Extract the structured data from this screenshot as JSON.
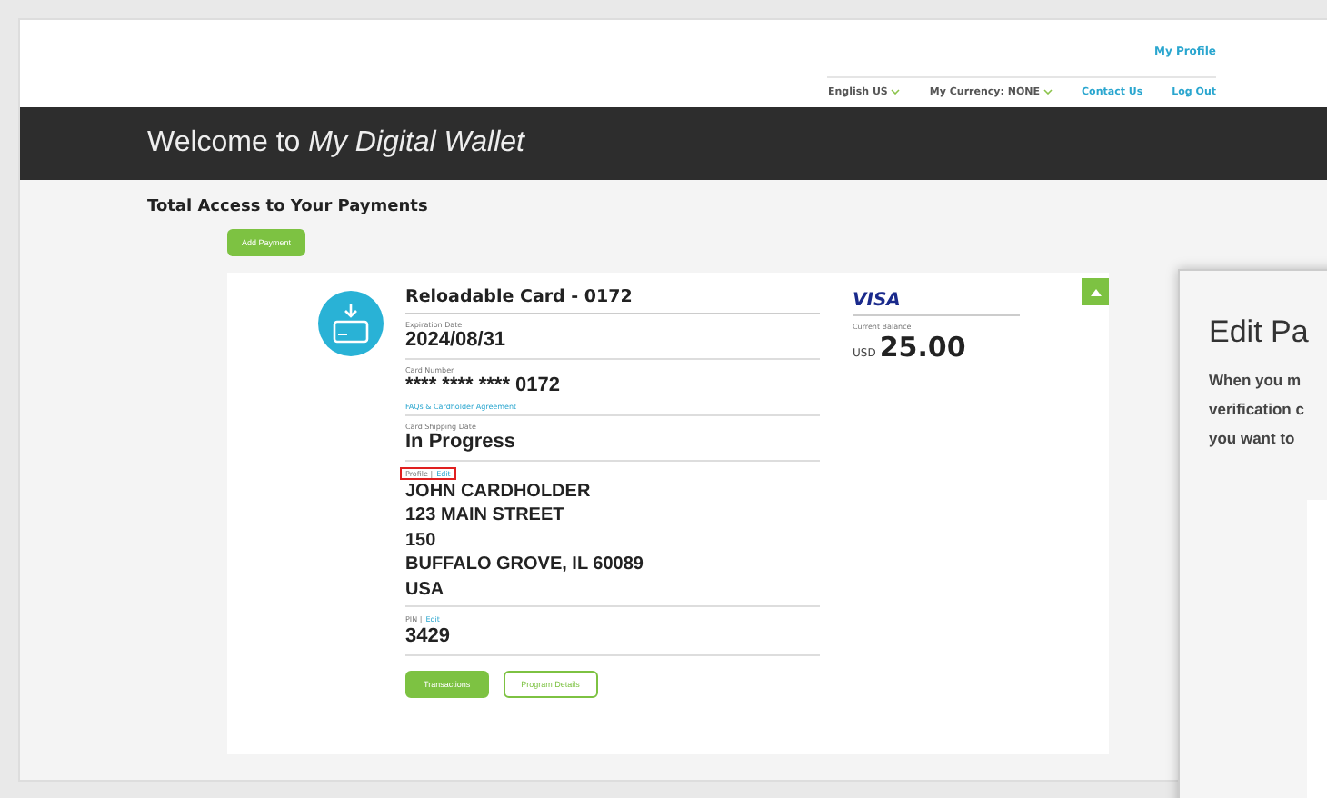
{
  "header": {
    "top_link": "My Profile",
    "menu": [
      {
        "label": "English US",
        "kind": "dropdown"
      },
      {
        "label": "My Currency: NONE",
        "kind": "dropdown"
      },
      {
        "label": "Contact Us",
        "kind": "link"
      },
      {
        "label": "Log Out",
        "kind": "link"
      }
    ]
  },
  "banner": {
    "title": "Welcome to *My Digital Wallet*"
  },
  "section_title": "Total Access to Your Payments",
  "add_button": "Add Payment",
  "card": {
    "title": "Reloadable Card - 0172",
    "brand": "VISA",
    "balance_label": "Current Balance",
    "currency": "USD",
    "balance": "25.00",
    "fields": [
      {
        "label": "Expiration Date",
        "value": [
          "2024/08/31"
        ]
      },
      {
        "label": "Card Number",
        "value": [
          "**** **** **** 0172"
        ],
        "footer_link": "FAQs & Cardholder Agreement"
      },
      {
        "label": "Card Shipping Date",
        "value": [
          "In Progress"
        ]
      },
      {
        "label": "Profile |",
        "link": "Edit",
        "highlighted": true,
        "value": [
          "JOHN CARDHOLDER",
          "123 MAIN STREET",
          "150",
          "BUFFALO GROVE, IL 60089",
          "USA"
        ]
      },
      {
        "label": "PIN |",
        "link": "Edit",
        "highlighted": false,
        "value": [
          "3429"
        ]
      }
    ],
    "buttons": [
      {
        "label": "Transactions",
        "kind": "primary"
      },
      {
        "label": "Program Details",
        "kind": "outline"
      }
    ]
  },
  "dialog": {
    "title": "Edit Pa",
    "lines": [
      "When you m",
      "verification c",
      "you want to"
    ]
  }
}
